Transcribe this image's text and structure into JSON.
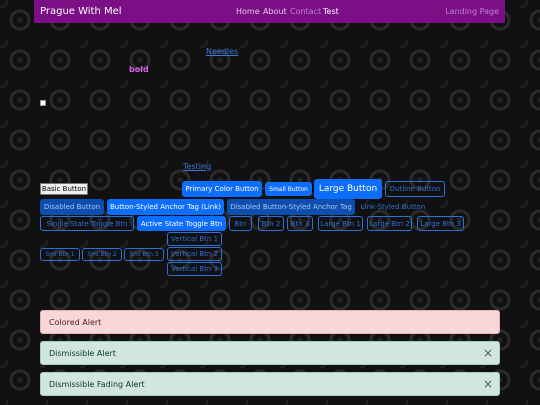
{
  "navbar": {
    "brand": "Prague With Mel",
    "links": [
      "Home",
      "About",
      "Contact",
      "Test"
    ],
    "right": "Landing Page"
  },
  "content": {
    "link1": "Needles",
    "bold": "bold",
    "link2": "Testing"
  },
  "buttons": {
    "basic": "Basic Button",
    "primary": "Primary Color Button",
    "small": "Small Button",
    "large": "Large Button",
    "outline": "Outline Button",
    "disabled": "Disabled Button",
    "anchor": "Button-Styled Anchor Tag (Link)",
    "disabled_anchor": "Disabled Button-Styled Anchor Tag",
    "link_styled": "Link-Styled Button",
    "single_toggle": "Single State Toggle Btn",
    "active_toggle": "Active State Toggle Btn",
    "group1": [
      "Btn",
      "Btn 2",
      "Btn 3"
    ],
    "group2": [
      "Large Btn 1",
      "Large Btn 2",
      "Large Btn 3"
    ],
    "vertical": [
      "Vertical Btn 1",
      "Vertical Btn 2",
      "Vertical Btn 3"
    ],
    "small_group": [
      "Sml Btn 1",
      "Sml Btn 2",
      "Sml Btn 3"
    ]
  },
  "alerts": {
    "colored": "Colored Alert",
    "dismissible": "Dismissible Alert",
    "fading": "Dismissible Fading Alert",
    "close_glyph": "×"
  },
  "colors": {
    "navbar": "#7a0f86",
    "primary": "#0d6efd",
    "danger_alert": "#f8d7da",
    "success_alert": "#d1e7dd"
  }
}
